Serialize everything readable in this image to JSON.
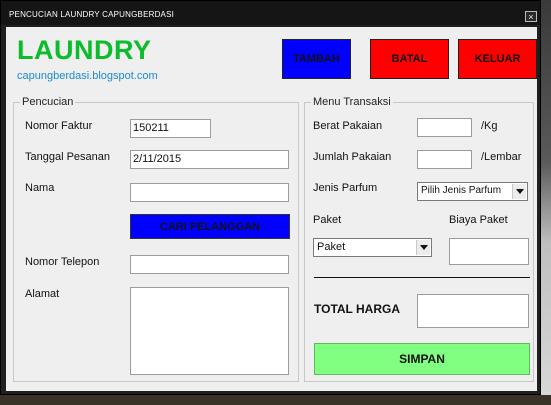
{
  "window": {
    "title": "PENCUCIAN LAUNDRY CAPUNGBERDASI",
    "close_glyph": "×"
  },
  "header": {
    "brand": "LAUNDRY",
    "blog": "capungberdasi.blogspot.com"
  },
  "toolbar": {
    "tambah": "TAMBAH",
    "batal": "BATAL",
    "keluar": "KELUAR"
  },
  "pencucian": {
    "legend": "Pencucian",
    "nomor_faktur_label": "Nomor Faktur",
    "nomor_faktur_value": "150211",
    "tanggal_label": "Tanggal Pesanan",
    "tanggal_value": "2/11/2015",
    "nama_label": "Nama",
    "nama_value": "",
    "cari_button": "CARI PELANGGAN",
    "telepon_label": "Nomor Telepon",
    "telepon_value": "",
    "alamat_label": "Alamat"
  },
  "transaksi": {
    "legend": "Menu Transaksi",
    "berat_label": "Berat Pakaian",
    "berat_unit": "/Kg",
    "jumlah_label": "Jumlah Pakaian",
    "jumlah_unit": "/Lembar",
    "parfum_label": "Jenis Parfum",
    "parfum_value": "Pilih Jenis Parfum",
    "paket_label": "Paket",
    "paket_value": "Paket",
    "biaya_label": "Biaya Paket",
    "total_label": "TOTAL HARGA",
    "simpan_button": "SIMPAN"
  },
  "colors": {
    "brand": "#0cbc2a",
    "blog": "#1a8bd0",
    "tambah_bg": "#0000ff",
    "batal_bg": "#ff0000",
    "keluar_bg": "#ff0000",
    "cari_bg": "#0000ff",
    "simpan_bg": "#80ff80"
  }
}
